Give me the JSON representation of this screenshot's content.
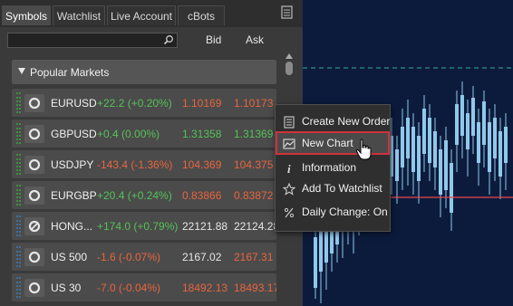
{
  "tabs": [
    {
      "label": "Symbols",
      "active": true
    },
    {
      "label": "Watchlist",
      "active": false
    },
    {
      "label": "Live Account",
      "active": false
    },
    {
      "label": "cBots",
      "active": false
    }
  ],
  "header": {
    "bid_label": "Bid",
    "ask_label": "Ask"
  },
  "search": {
    "placeholder": "",
    "value": ""
  },
  "group": {
    "label": "Popular Markets",
    "expanded": true
  },
  "rows": [
    {
      "name": "EURUSD",
      "change": "+22.2 (+0.20%)",
      "dir": "up",
      "bid": "1.10169",
      "ask": "1.10173",
      "bid_dir": "down",
      "ask_dir": "down",
      "grip_color": "#3f8f3f",
      "icon": "circle-icon"
    },
    {
      "name": "GBPUSD",
      "change": "+0.4 (0.00%)",
      "dir": "up",
      "bid": "1.31358",
      "ask": "1.31369",
      "bid_dir": "up",
      "ask_dir": "up",
      "grip_color": "#3f8f3f",
      "icon": "circle-icon"
    },
    {
      "name": "USDJPY",
      "change": "-143.4 (-1.36%)",
      "dir": "down",
      "bid": "104.369",
      "ask": "104.375",
      "bid_dir": "down",
      "ask_dir": "down",
      "grip_color": "#3f8f3f",
      "icon": "circle-icon"
    },
    {
      "name": "EURGBP",
      "change": "+20.4 (+0.24%)",
      "dir": "up",
      "bid": "0.83866",
      "ask": "0.83872",
      "bid_dir": "down",
      "ask_dir": "down",
      "grip_color": "#3f8f3f",
      "icon": "circle-icon"
    },
    {
      "name": "HONG...",
      "change": "+174.0 (+0.79%)",
      "dir": "up",
      "bid": "22121.88",
      "ask": "22124.28",
      "bid_dir": "neutral",
      "ask_dir": "neutral",
      "grip_color": "#3f6f9f",
      "icon": "closed-market-icon"
    },
    {
      "name": "US 500",
      "change": "-1.6 (-0.07%)",
      "dir": "down",
      "bid": "2167.02",
      "ask": "2167.31",
      "bid_dir": "neutral",
      "ask_dir": "down",
      "grip_color": "#3f6f9f",
      "icon": "circle-icon"
    },
    {
      "name": "US 30",
      "change": "-7.0 (-0.04%)",
      "dir": "down",
      "bid": "18492.13",
      "ask": "18493.17",
      "bid_dir": "down",
      "ask_dir": "down",
      "grip_color": "#3f6f9f",
      "icon": "circle-icon"
    }
  ],
  "context_menu": {
    "items": [
      {
        "label": "Create New Order",
        "icon": "order-document-icon",
        "highlighted": false
      },
      {
        "label": "New Chart",
        "icon": "chart-icon",
        "highlighted": true
      },
      {
        "label": "Information",
        "icon": "info-icon",
        "highlighted": false
      },
      {
        "label": "Add To Watchlist",
        "icon": "star-icon",
        "highlighted": false
      },
      {
        "label": "Daily Change: On",
        "icon": "percent-icon",
        "highlighted": false
      }
    ]
  },
  "colors": {
    "up": "#55c257",
    "down": "#e8653f",
    "chart_background": "#0c1b3c",
    "candle": "#8ec9ea",
    "price_line": "#e84a4a",
    "highlight_outline": "#d0313b"
  }
}
